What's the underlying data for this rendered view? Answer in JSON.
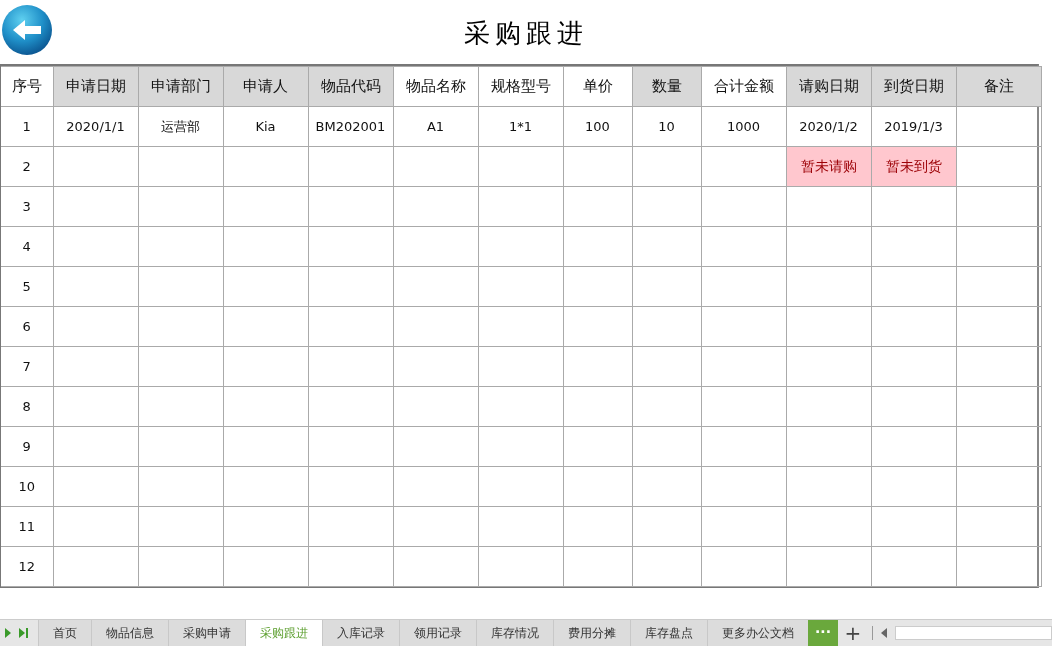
{
  "title": "采购跟进",
  "table": {
    "columns": [
      {
        "label": "序号",
        "shaded": false
      },
      {
        "label": "申请日期",
        "shaded": true
      },
      {
        "label": "申请部门",
        "shaded": true
      },
      {
        "label": "申请人",
        "shaded": true
      },
      {
        "label": "物品代码",
        "shaded": true
      },
      {
        "label": "物品名称",
        "shaded": false
      },
      {
        "label": "规格型号",
        "shaded": false
      },
      {
        "label": "单价",
        "shaded": false
      },
      {
        "label": "数量",
        "shaded": true
      },
      {
        "label": "合计金额",
        "shaded": false
      },
      {
        "label": "请购日期",
        "shaded": true
      },
      {
        "label": "到货日期",
        "shaded": true
      },
      {
        "label": "备注",
        "shaded": true
      }
    ],
    "rows": [
      {
        "cells": [
          {
            "text": "1"
          },
          {
            "text": "2020/1/1"
          },
          {
            "text": "运营部"
          },
          {
            "text": "Kia"
          },
          {
            "text": "BM202001"
          },
          {
            "text": "A1"
          },
          {
            "text": "1*1"
          },
          {
            "text": "100"
          },
          {
            "text": "10"
          },
          {
            "text": "1000"
          },
          {
            "text": "2020/1/2"
          },
          {
            "text": "2019/1/3"
          },
          {}
        ]
      },
      {
        "cells": [
          {
            "text": "2"
          },
          {},
          {},
          {},
          {},
          {},
          {},
          {},
          {},
          {},
          {
            "text": "暂未请购",
            "alert": true
          },
          {
            "text": "暂未到货",
            "alert": true
          },
          {}
        ]
      },
      {
        "cells": [
          {
            "text": "3"
          }
        ]
      },
      {
        "cells": [
          {
            "text": "4"
          }
        ]
      },
      {
        "cells": [
          {
            "text": "5"
          }
        ]
      },
      {
        "cells": [
          {
            "text": "6"
          }
        ]
      },
      {
        "cells": [
          {
            "text": "7"
          }
        ]
      },
      {
        "cells": [
          {
            "text": "8"
          }
        ]
      },
      {
        "cells": [
          {
            "text": "9"
          }
        ]
      },
      {
        "cells": [
          {
            "text": "10"
          }
        ]
      },
      {
        "cells": [
          {
            "text": "11"
          }
        ]
      },
      {
        "cells": [
          {
            "text": "12"
          }
        ]
      }
    ]
  },
  "sheet_tabs": [
    {
      "label": "首页",
      "selected": false
    },
    {
      "label": "物品信息",
      "selected": false
    },
    {
      "label": "采购申请",
      "selected": false
    },
    {
      "label": "采购跟进",
      "selected": true
    },
    {
      "label": "入库记录",
      "selected": false
    },
    {
      "label": "领用记录",
      "selected": false
    },
    {
      "label": "库存情况",
      "selected": false
    },
    {
      "label": "费用分摊",
      "selected": false
    },
    {
      "label": "库存盘点",
      "selected": false
    },
    {
      "label": "更多办公文档",
      "selected": false
    }
  ],
  "more_button": "···",
  "add_button": "+"
}
